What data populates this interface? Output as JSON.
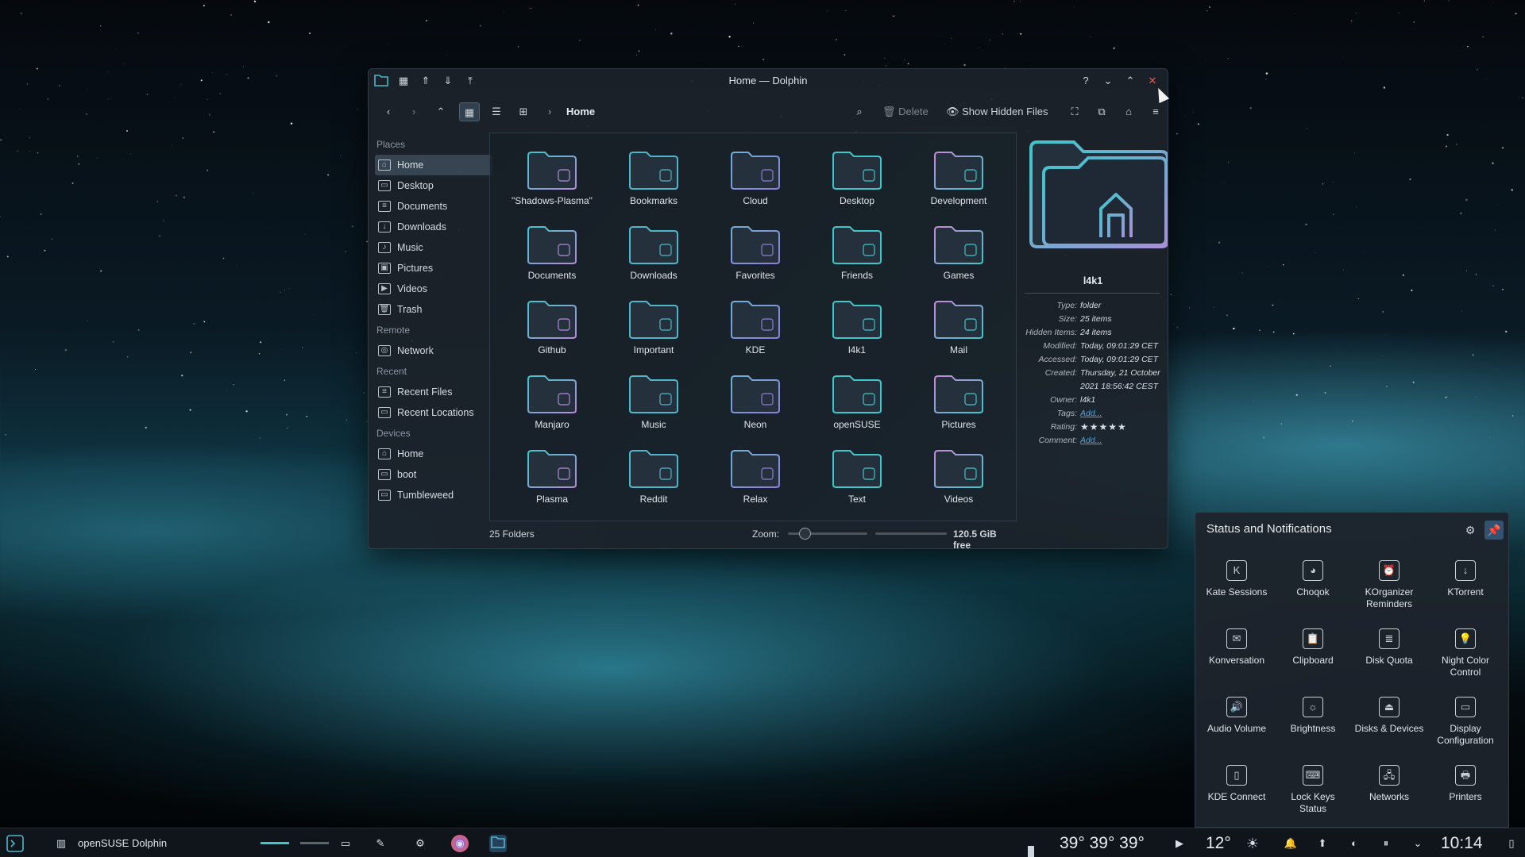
{
  "window": {
    "title": "Home — Dolphin",
    "help_label": "?",
    "breadcrumb": "Home",
    "delete_label": "Delete",
    "hidden_label": "Show Hidden Files"
  },
  "places": {
    "sections": [
      {
        "header": "Places",
        "items": [
          "Home",
          "Desktop",
          "Documents",
          "Downloads",
          "Music",
          "Pictures",
          "Videos",
          "Trash"
        ]
      },
      {
        "header": "Remote",
        "items": [
          "Network"
        ]
      },
      {
        "header": "Recent",
        "items": [
          "Recent Files",
          "Recent Locations"
        ]
      },
      {
        "header": "Devices",
        "items": [
          "Home",
          "boot",
          "Tumbleweed"
        ]
      }
    ]
  },
  "folders": [
    "\"Shadows-Plasma\"",
    "Bookmarks",
    "Cloud",
    "Desktop",
    "Development",
    "Documents",
    "Downloads",
    "Favorites",
    "Friends",
    "Games",
    "Github",
    "Important",
    "KDE",
    "l4k1",
    "Mail",
    "Manjaro",
    "Music",
    "Neon",
    "openSUSE",
    "Pictures",
    "Plasma",
    "Reddit",
    "Relax",
    "Text",
    "Videos"
  ],
  "status": {
    "count": "25 Folders",
    "zoom_label": "Zoom:",
    "free": "120.5 GiB free"
  },
  "info": {
    "name": "l4k1",
    "rows": [
      {
        "k": "Type:",
        "v": "folder"
      },
      {
        "k": "Size:",
        "v": "25 items"
      },
      {
        "k": "Hidden Items:",
        "v": "24 items"
      },
      {
        "k": "Modified:",
        "v": "Today, 09:01:29 CET"
      },
      {
        "k": "Accessed:",
        "v": "Today, 09:01:29 CET"
      },
      {
        "k": "Created:",
        "v": "Thursday, 21 October 2021 18:56:42 CEST"
      },
      {
        "k": "Owner:",
        "v": "l4k1"
      },
      {
        "k": "Tags:",
        "v": "Add..."
      },
      {
        "k": "Rating:",
        "v": "★★★★★"
      },
      {
        "k": "Comment:",
        "v": "Add..."
      }
    ]
  },
  "tray": {
    "title": "Status and Notifications",
    "items": [
      {
        "label": "Kate Sessions",
        "icon": "kate-icon"
      },
      {
        "label": "Choqok",
        "icon": "choqok-icon"
      },
      {
        "label": "KOrganizer Reminders",
        "icon": "alarm-icon"
      },
      {
        "label": "KTorrent",
        "icon": "torrent-icon"
      },
      {
        "label": "Konversation",
        "icon": "chat-icon"
      },
      {
        "label": "Clipboard",
        "icon": "clipboard-icon"
      },
      {
        "label": "Disk Quota",
        "icon": "disk-quota-icon"
      },
      {
        "label": "Night Color Control",
        "icon": "bulb-icon"
      },
      {
        "label": "Audio Volume",
        "icon": "speaker-icon"
      },
      {
        "label": "Brightness",
        "icon": "brightness-icon"
      },
      {
        "label": "Disks & Devices",
        "icon": "usb-icon"
      },
      {
        "label": "Display Configuration",
        "icon": "display-icon"
      },
      {
        "label": "KDE Connect",
        "icon": "phone-icon"
      },
      {
        "label": "Lock Keys Status",
        "icon": "keyboard-icon"
      },
      {
        "label": "Networks",
        "icon": "network-icon"
      },
      {
        "label": "Printers",
        "icon": "printer-icon"
      }
    ]
  },
  "taskbar": {
    "activity": "openSUSE",
    "app": "Dolphin",
    "temps": "39°  39°  39°",
    "weather": "12°",
    "clock": "10:14"
  },
  "colors": {
    "accent": "#3fc6c9",
    "folder_top": "#4fb6c9",
    "folder_body": "#25303c",
    "wallpaper_glow": "#46c8e6"
  }
}
